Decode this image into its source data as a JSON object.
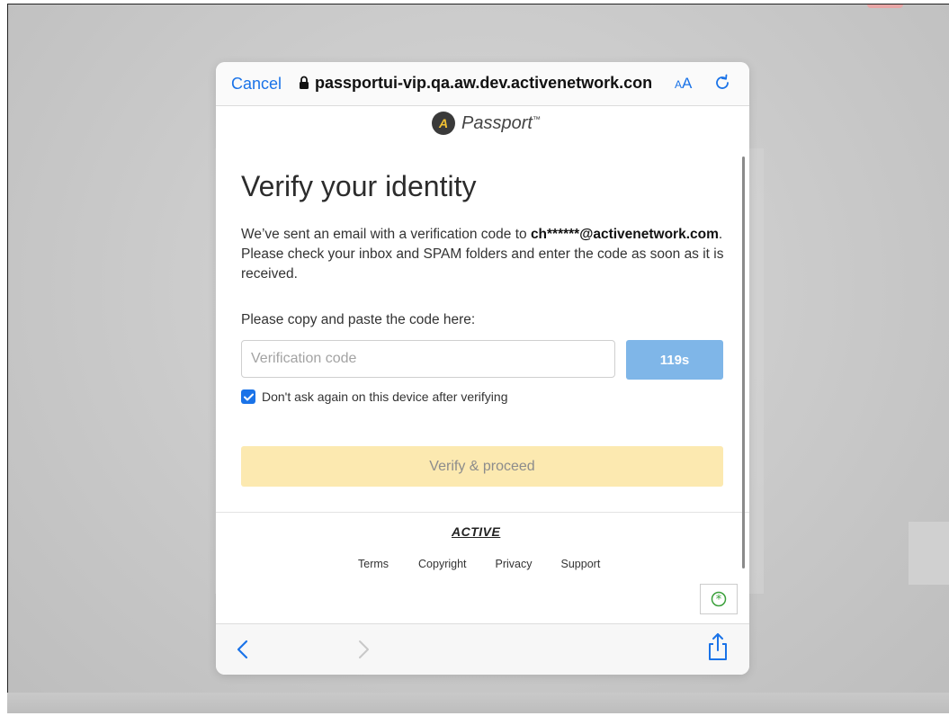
{
  "browser": {
    "cancel_label": "Cancel",
    "url": "passportui-vip.qa.aw.dev.activenetwork.con",
    "text_size_small": "A",
    "text_size_big": "A"
  },
  "brand": {
    "badge": "A",
    "name": "Passport",
    "tm": "™"
  },
  "page": {
    "title": "Verify your identity",
    "desc_before": "We’ve sent an email with a verification code to ",
    "email_masked": "ch******@activenetwork.com",
    "desc_after": ". Please check your inbox and SPAM folders and enter the code as soon as it is received.",
    "code_prompt": "Please copy and paste the code here:",
    "code_placeholder": "Verification code",
    "timer_label": "119s",
    "remember_label": "Don't ask again on this device after verifying",
    "remember_checked": true,
    "verify_label": "Verify & proceed"
  },
  "footer": {
    "logo": "ACTIVE",
    "links": [
      "Terms",
      "Copyright",
      "Privacy",
      "Support"
    ]
  },
  "colors": {
    "accent": "#1a73e8",
    "timer_button": "#7fb6e8",
    "verify_button": "#fce9b0",
    "help_icon": "#3aa03a"
  },
  "icons": {
    "lock": "lock-icon",
    "reload": "reload-icon",
    "back": "chevron-left-icon",
    "forward": "chevron-right-icon",
    "share": "share-icon",
    "help": "help-star-icon"
  }
}
